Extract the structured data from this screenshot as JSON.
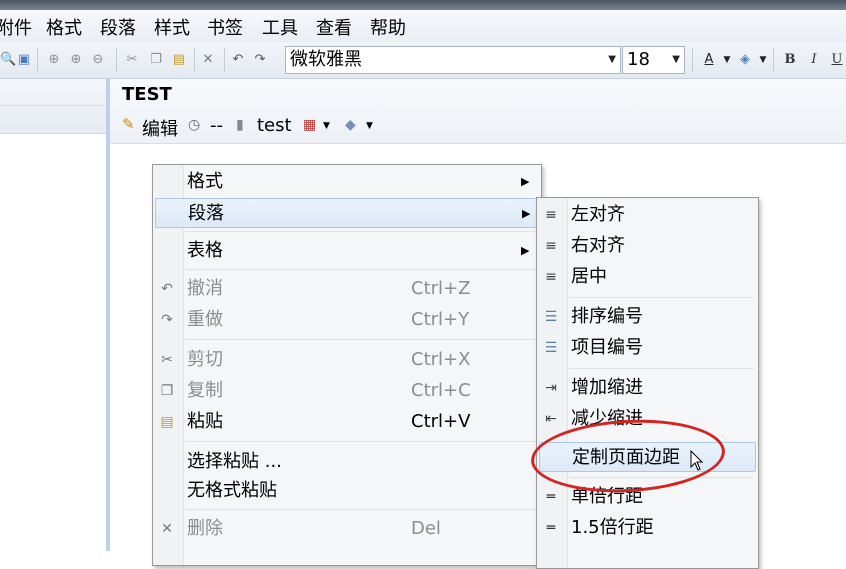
{
  "menubar": {
    "items": [
      "附件",
      "格式",
      "段落",
      "样式",
      "书签",
      "工具",
      "查看",
      "帮助"
    ]
  },
  "toolbar": {
    "font_name": "微软雅黑",
    "font_size": "18",
    "bold": "B",
    "italic": "I",
    "underline": "U"
  },
  "document": {
    "title": "TEST",
    "edit_label": "编辑",
    "time_value": "--",
    "notebook": "test"
  },
  "context_menu": {
    "items": [
      {
        "label": "格式",
        "submenu": true
      },
      {
        "label": "段落",
        "submenu": true
      },
      {
        "label": "表格",
        "submenu": true
      },
      {
        "label": "撤消",
        "shortcut": "Ctrl+Z"
      },
      {
        "label": "重做",
        "shortcut": "Ctrl+Y"
      },
      {
        "label": "剪切",
        "shortcut": "Ctrl+X"
      },
      {
        "label": "复制",
        "shortcut": "Ctrl+C"
      },
      {
        "label": "粘贴",
        "shortcut": "Ctrl+V"
      },
      {
        "label": "选择粘贴 ..."
      },
      {
        "label": "无格式粘贴"
      },
      {
        "label": "删除",
        "shortcut": "Del"
      }
    ]
  },
  "submenu": {
    "items": [
      {
        "label": "左对齐"
      },
      {
        "label": "右对齐"
      },
      {
        "label": "居中"
      },
      {
        "label": "排序编号"
      },
      {
        "label": "项目编号"
      },
      {
        "label": "增加缩进"
      },
      {
        "label": "减少缩进"
      },
      {
        "label": "定制页面边距"
      },
      {
        "label": "单倍行距"
      },
      {
        "label": "1.5倍行距"
      }
    ]
  },
  "colors": {
    "highlight_oval": "#d42323",
    "menu_bg": "#f5f6f7",
    "accent": "#b9d0ef"
  }
}
